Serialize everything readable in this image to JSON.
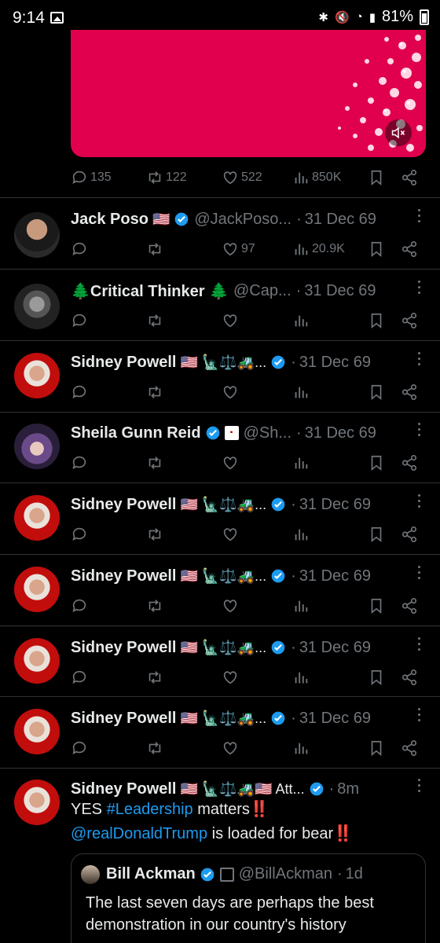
{
  "status_bar": {
    "time": "9:14",
    "battery": "81%"
  },
  "top_tweet": {
    "replies": "135",
    "reposts": "122",
    "likes": "522",
    "views": "850K"
  },
  "tweets": [
    {
      "name": "Jack Poso",
      "flag": "🇺🇸",
      "verified": true,
      "handle": "@JackPoso...",
      "date": "31 Dec 69",
      "likes": "97",
      "views": "20.9K"
    },
    {
      "name": "🌲Critical Thinker 🌲",
      "verified": false,
      "handle": "@Cap...",
      "date": "31 Dec 69"
    },
    {
      "name": "Sidney Powell",
      "flag": "🇺🇸 🗽⚖️🚜...",
      "verified": true,
      "date": "31 Dec 69"
    },
    {
      "name": "Sheila Gunn Reid",
      "verified": true,
      "badge": "▪",
      "handle": "@Sh...",
      "date": "31 Dec 69"
    },
    {
      "name": "Sidney Powell",
      "flag": "🇺🇸 🗽⚖️🚜...",
      "verified": true,
      "date": "31 Dec 69"
    },
    {
      "name": "Sidney Powell",
      "flag": "🇺🇸 🗽⚖️🚜...",
      "verified": true,
      "date": "31 Dec 69"
    },
    {
      "name": "Sidney Powell",
      "flag": "🇺🇸 🗽⚖️🚜...",
      "verified": true,
      "date": "31 Dec 69"
    },
    {
      "name": "Sidney Powell",
      "flag": "🇺🇸 🗽⚖️🚜...",
      "verified": true,
      "date": "31 Dec 69"
    }
  ],
  "last_tweet": {
    "name": "Sidney Powell",
    "flag": "🇺🇸 🗽⚖️🚜🇺🇸 Att...",
    "date": "8m",
    "text_yes": "YES ",
    "hashtag": "#Leadership",
    "text_matters": " matters",
    "mention": "@realDonaldTrump",
    "text_loaded": " is loaded for bear",
    "bangs": "‼️"
  },
  "quote": {
    "name": "Bill Ackman",
    "handle": "@BillAckman",
    "date": "1d",
    "text": "The last seven days are perhaps the best demonstration in our country's history"
  },
  "colors": {
    "accent": "#1d9bf0",
    "muted": "#71767b",
    "media_bg": "#e0004e"
  }
}
